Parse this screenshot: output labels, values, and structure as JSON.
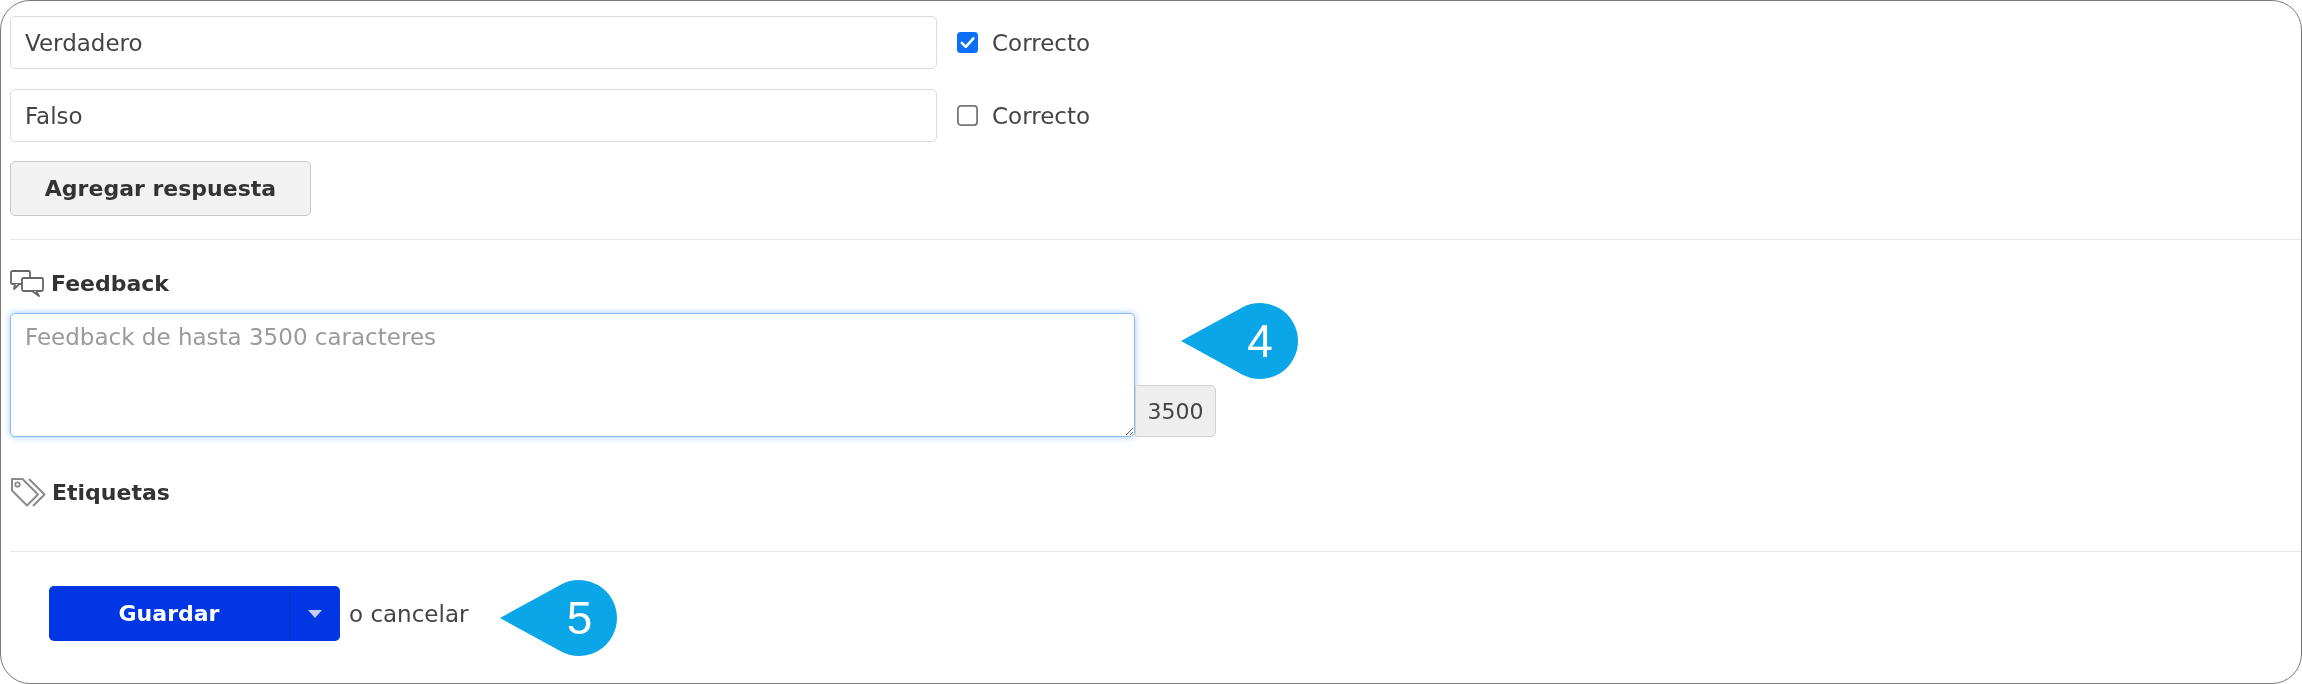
{
  "answers": [
    {
      "value": "Verdadero",
      "checked": true,
      "label": "Correcto"
    },
    {
      "value": "Falso",
      "checked": false,
      "label": "Correcto"
    }
  ],
  "add_answer_button": "Agregar respuesta",
  "feedback": {
    "title": "Feedback",
    "placeholder": "Feedback de hasta 3500 caracteres",
    "counter": "3500",
    "focused": true,
    "callout": "4"
  },
  "tags": {
    "title": "Etiquetas"
  },
  "footer": {
    "save_button": "Guardar",
    "cancel_text": "o cancelar",
    "callout": "5"
  }
}
